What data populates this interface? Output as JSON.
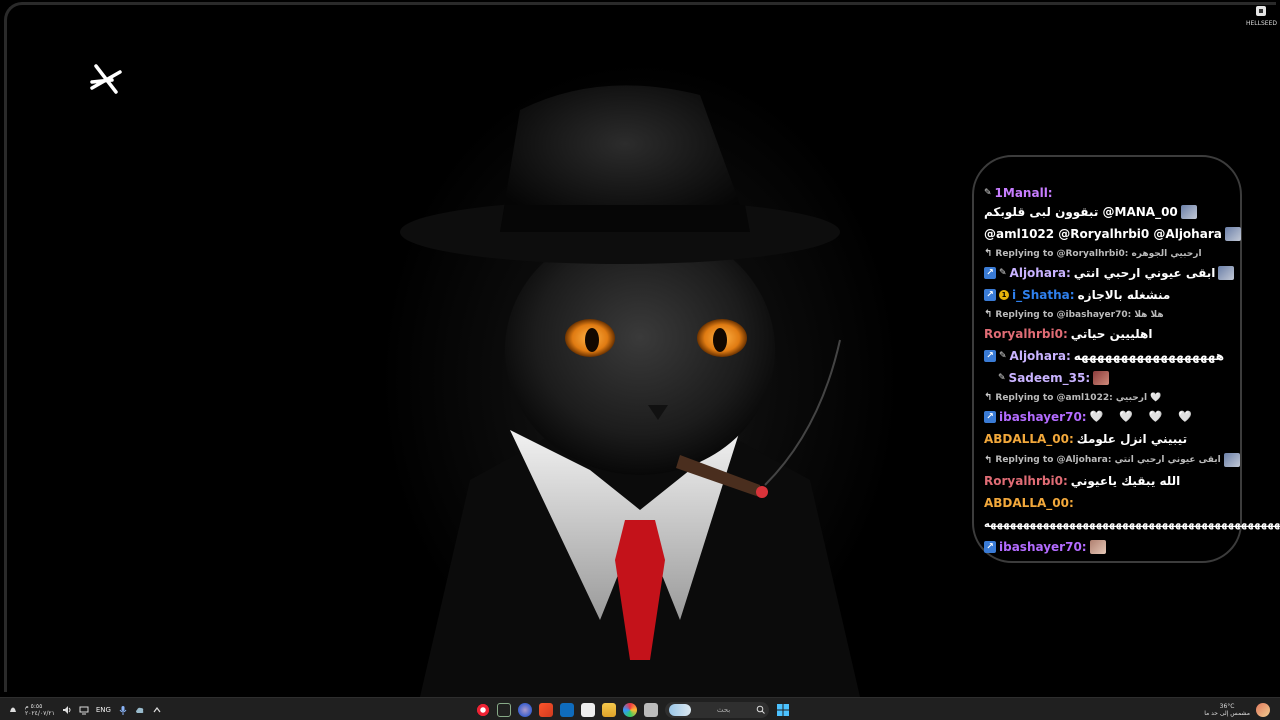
{
  "desktop": {
    "corner_app_label": "HELLSEED"
  },
  "chat": {
    "messages": [
      {
        "kind": "msg",
        "user": "1Manall:",
        "user_color": "#c77dff",
        "prefix": "pin",
        "text": "تبقوون لبى قلوبكم @MANA_00",
        "emote": "blue"
      },
      {
        "kind": "msg",
        "user": "",
        "user_color": "#ffffff",
        "text": "@aml1022 @Roryalhrbi0 @Aljohara",
        "emote": "blue"
      },
      {
        "kind": "reply",
        "text": "Replying to @Roryalhrbi0: ارحبيي الجوهره"
      },
      {
        "kind": "msg",
        "user": "Aljohara:",
        "user_color": "#c9b3ff",
        "prefix": "badge-pin",
        "text": "ابقى عيوني ارحبي انتي",
        "emote": "blue"
      },
      {
        "kind": "msg",
        "user": "i_Shatha:",
        "user_color": "#2f80ed",
        "prefix": "badge-coin",
        "text": "منشغله بالاجازه"
      },
      {
        "kind": "reply",
        "text": "Replying to @ibashayer70: هلا هلا"
      },
      {
        "kind": "msg",
        "user": "Roryalhrbi0:",
        "user_color": "#e06c75",
        "text": "اهلييين حياتي"
      },
      {
        "kind": "msg",
        "user": "Aljohara:",
        "user_color": "#c9b3ff",
        "prefix": "badge-pin",
        "text": "ههههههههههههههههههه"
      },
      {
        "kind": "msg",
        "user": "Sadeem_35:",
        "user_color": "#c9b3ff",
        "prefix": "pin-indent",
        "text": "",
        "emote": "red"
      },
      {
        "kind": "reply",
        "text": "Replying to @aml1022: ارحبيي 🤍"
      },
      {
        "kind": "msg",
        "user": "ibashayer70:",
        "user_color": "#b36bff",
        "prefix": "badge",
        "text": "🤍 🤍 🤍 🤍",
        "hearts": true
      },
      {
        "kind": "msg",
        "user": "ABDALLA_00:",
        "user_color": "#f2a83b",
        "text": "تيبيني انزل علومك"
      },
      {
        "kind": "reply",
        "text": "Replying to @Aljohara: ابقى عيوني ارحبي انتي",
        "emote": "blue"
      },
      {
        "kind": "msg",
        "user": "Roryalhrbi0:",
        "user_color": "#e06c75",
        "text": "الله يبقيك ياعيوني"
      },
      {
        "kind": "msg",
        "user": "ABDALLA_00:",
        "user_color": "#f2a83b",
        "text": ""
      },
      {
        "kind": "msg",
        "user": "",
        "user_color": "#ffffff",
        "text": "ههههههههههههههههههههههههههههههههههههههههههههههه",
        "wide": true
      },
      {
        "kind": "msg",
        "user": "ibashayer70:",
        "user_color": "#b36bff",
        "prefix": "badge",
        "text": "",
        "emote": "face"
      }
    ]
  },
  "taskbar": {
    "clock_time": "٥:٥٥ م",
    "clock_date": "٢٠٢٤/٠٧/٢١",
    "language": "ENG",
    "search_placeholder": "بحث",
    "weather_temp": "36°C",
    "weather_text": "مشمس إلى حد ما"
  }
}
